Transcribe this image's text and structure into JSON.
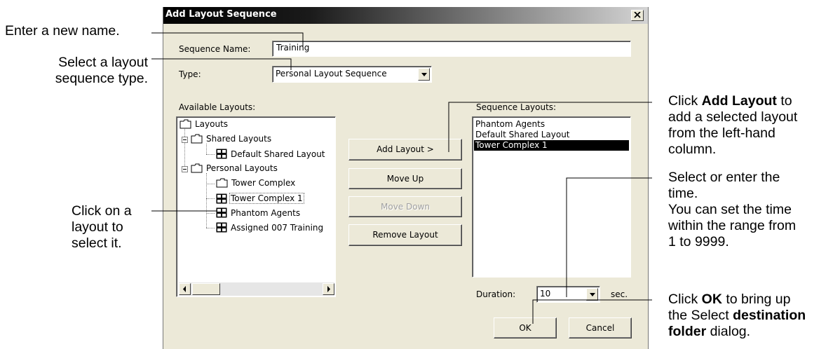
{
  "dialog": {
    "title": "Add Layout Sequence",
    "sequence_name_label": "Sequence Name:",
    "sequence_name_value": "Training",
    "type_label": "Type:",
    "type_value": "Personal Layout Sequence",
    "available_label": "Available Layouts:",
    "sequence_layouts_label": "Sequence Layouts:",
    "tree": {
      "root": "Layouts",
      "shared": "Shared Layouts",
      "shared_items": [
        "Default Shared Layout"
      ],
      "personal": "Personal Layouts",
      "personal_folder": "Tower Complex",
      "personal_items": [
        "Tower Complex 1",
        "Phantom Agents",
        "Assigned 007 Training"
      ]
    },
    "sequence_layouts": [
      "Phantom Agents",
      "Default Shared Layout",
      "Tower Complex 1"
    ],
    "buttons": {
      "add_layout": "Add Layout  >",
      "move_up": "Move Up",
      "move_down": "Move Down",
      "remove_layout": "Remove Layout",
      "ok": "OK",
      "cancel": "Cancel"
    },
    "duration_label": "Duration:",
    "duration_value": "10",
    "duration_unit": "sec."
  },
  "annotations": {
    "enter_name": "Enter a new name.",
    "select_type": "Select a layout\nsequence type.",
    "click_layout": "Click on a\nlayout to\nselect it.",
    "add_layout_prefix": "Click ",
    "add_layout_bold": "Add Layout",
    "add_layout_suffix": " to\nadd a selected layout\nfrom the left-hand\ncolumn.",
    "time": "Select or enter the\ntime.\nYou can set the time\nwithin the range from\n1 to 9999.",
    "ok_prefix": "Click ",
    "ok_bold": "OK",
    "ok_mid": " to bring up\nthe Select ",
    "ok_bold2": "destination\nfolder",
    "ok_suffix": " dialog."
  }
}
